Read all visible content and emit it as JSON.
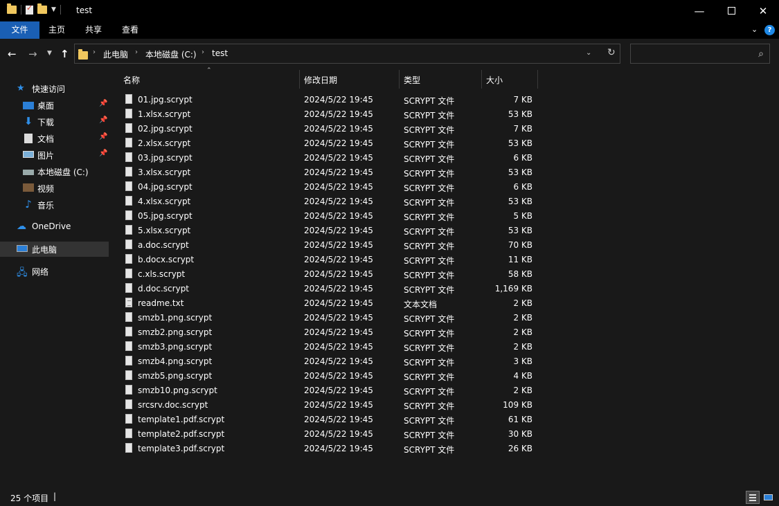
{
  "window": {
    "title": "test"
  },
  "ribbon": {
    "tabs": [
      "文件",
      "主页",
      "共享",
      "查看"
    ]
  },
  "address": {
    "crumbs": [
      "此电脑",
      "本地磁盘 (C:)",
      "test"
    ],
    "search_placeholder": ""
  },
  "sidebar": {
    "quick_access": "快速访问",
    "items": [
      {
        "label": "桌面",
        "pinned": true
      },
      {
        "label": "下载",
        "pinned": true
      },
      {
        "label": "文档",
        "pinned": true
      },
      {
        "label": "图片",
        "pinned": true
      },
      {
        "label": "本地磁盘 (C:)",
        "pinned": false
      },
      {
        "label": "视频",
        "pinned": false
      },
      {
        "label": "音乐",
        "pinned": false
      }
    ],
    "onedrive": "OneDrive",
    "this_pc": "此电脑",
    "network": "网络"
  },
  "columns": {
    "name": "名称",
    "date": "修改日期",
    "type": "类型",
    "size": "大小"
  },
  "files": [
    {
      "name": "01.jpg.scrypt",
      "date": "2024/5/22 19:45",
      "type": "SCRYPT 文件",
      "size": "7 KB"
    },
    {
      "name": "1.xlsx.scrypt",
      "date": "2024/5/22 19:45",
      "type": "SCRYPT 文件",
      "size": "53 KB"
    },
    {
      "name": "02.jpg.scrypt",
      "date": "2024/5/22 19:45",
      "type": "SCRYPT 文件",
      "size": "7 KB"
    },
    {
      "name": "2.xlsx.scrypt",
      "date": "2024/5/22 19:45",
      "type": "SCRYPT 文件",
      "size": "53 KB"
    },
    {
      "name": "03.jpg.scrypt",
      "date": "2024/5/22 19:45",
      "type": "SCRYPT 文件",
      "size": "6 KB"
    },
    {
      "name": "3.xlsx.scrypt",
      "date": "2024/5/22 19:45",
      "type": "SCRYPT 文件",
      "size": "53 KB"
    },
    {
      "name": "04.jpg.scrypt",
      "date": "2024/5/22 19:45",
      "type": "SCRYPT 文件",
      "size": "6 KB"
    },
    {
      "name": "4.xlsx.scrypt",
      "date": "2024/5/22 19:45",
      "type": "SCRYPT 文件",
      "size": "53 KB"
    },
    {
      "name": "05.jpg.scrypt",
      "date": "2024/5/22 19:45",
      "type": "SCRYPT 文件",
      "size": "5 KB"
    },
    {
      "name": "5.xlsx.scrypt",
      "date": "2024/5/22 19:45",
      "type": "SCRYPT 文件",
      "size": "53 KB"
    },
    {
      "name": "a.doc.scrypt",
      "date": "2024/5/22 19:45",
      "type": "SCRYPT 文件",
      "size": "70 KB"
    },
    {
      "name": "b.docx.scrypt",
      "date": "2024/5/22 19:45",
      "type": "SCRYPT 文件",
      "size": "11 KB"
    },
    {
      "name": "c.xls.scrypt",
      "date": "2024/5/22 19:45",
      "type": "SCRYPT 文件",
      "size": "58 KB"
    },
    {
      "name": "d.doc.scrypt",
      "date": "2024/5/22 19:45",
      "type": "SCRYPT 文件",
      "size": "1,169 KB"
    },
    {
      "name": "readme.txt",
      "date": "2024/5/22 19:45",
      "type": "文本文档",
      "size": "2 KB"
    },
    {
      "name": "smzb1.png.scrypt",
      "date": "2024/5/22 19:45",
      "type": "SCRYPT 文件",
      "size": "2 KB"
    },
    {
      "name": "smzb2.png.scrypt",
      "date": "2024/5/22 19:45",
      "type": "SCRYPT 文件",
      "size": "2 KB"
    },
    {
      "name": "smzb3.png.scrypt",
      "date": "2024/5/22 19:45",
      "type": "SCRYPT 文件",
      "size": "2 KB"
    },
    {
      "name": "smzb4.png.scrypt",
      "date": "2024/5/22 19:45",
      "type": "SCRYPT 文件",
      "size": "3 KB"
    },
    {
      "name": "smzb5.png.scrypt",
      "date": "2024/5/22 19:45",
      "type": "SCRYPT 文件",
      "size": "4 KB"
    },
    {
      "name": "smzb10.png.scrypt",
      "date": "2024/5/22 19:45",
      "type": "SCRYPT 文件",
      "size": "2 KB"
    },
    {
      "name": "srcsrv.doc.scrypt",
      "date": "2024/5/22 19:45",
      "type": "SCRYPT 文件",
      "size": "109 KB"
    },
    {
      "name": "template1.pdf.scrypt",
      "date": "2024/5/22 19:45",
      "type": "SCRYPT 文件",
      "size": "61 KB"
    },
    {
      "name": "template2.pdf.scrypt",
      "date": "2024/5/22 19:45",
      "type": "SCRYPT 文件",
      "size": "30 KB"
    },
    {
      "name": "template3.pdf.scrypt",
      "date": "2024/5/22 19:45",
      "type": "SCRYPT 文件",
      "size": "26 KB"
    }
  ],
  "status": {
    "item_count": "25 个项目"
  },
  "colors": {
    "background": "#191919",
    "titlebar": "#000000",
    "accent": "#1a5fb4",
    "folder": "#f0c75e",
    "text": "#ffffff"
  }
}
